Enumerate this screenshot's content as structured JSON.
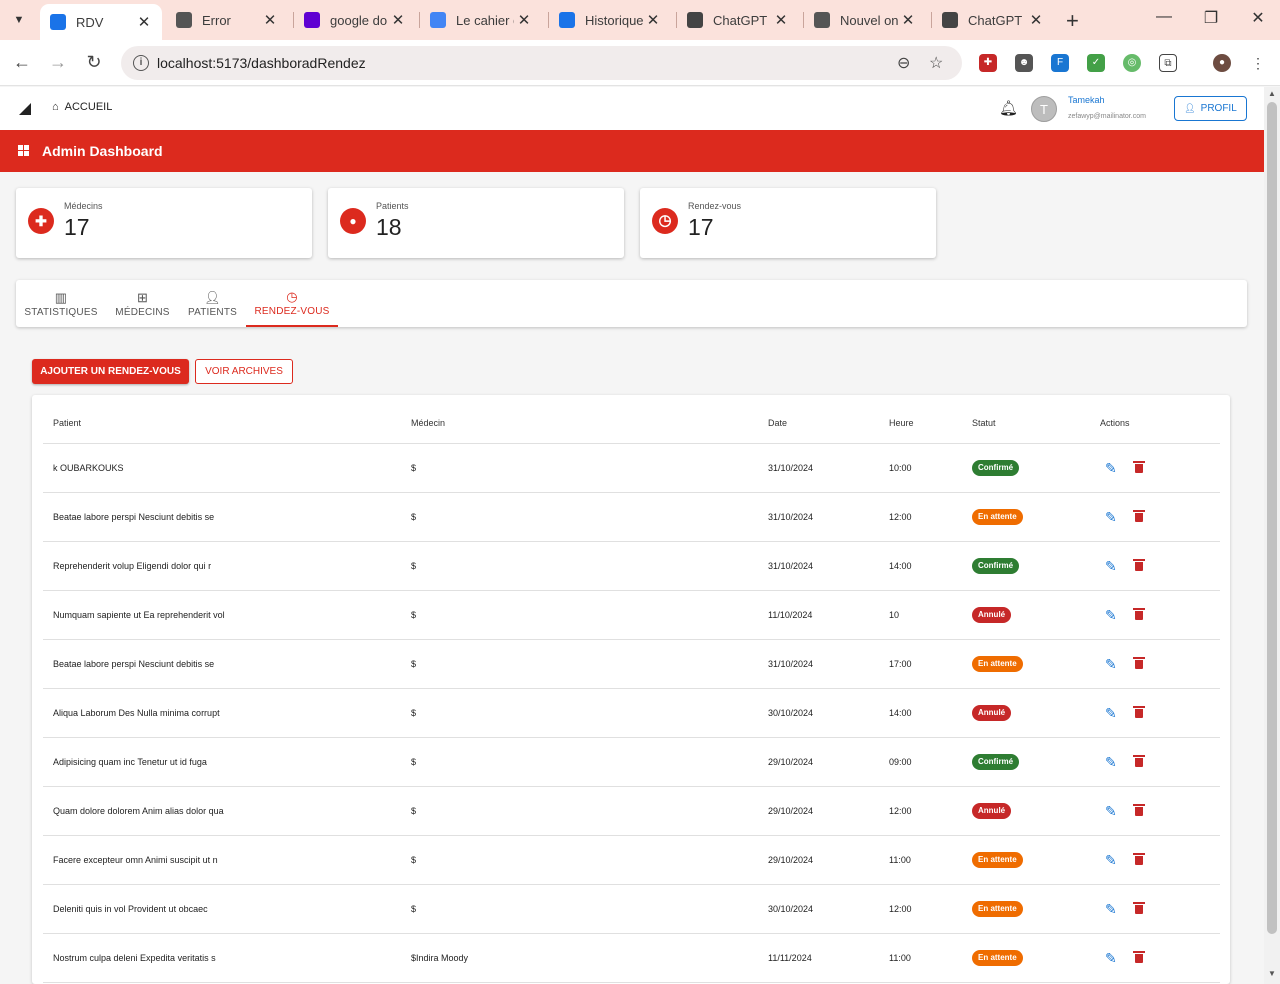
{
  "browser": {
    "tabs": [
      {
        "title": "RDV",
        "icon": "docs-icon",
        "color": "#1a73e8",
        "active": true
      },
      {
        "title": "Error",
        "icon": "globe-icon",
        "color": "#555555"
      },
      {
        "title": "google do",
        "icon": "yahoo-icon",
        "color": "#6001d2"
      },
      {
        "title": "Le cahier d",
        "icon": "docs-icon",
        "color": "#4285f4"
      },
      {
        "title": "Historique",
        "icon": "download-icon",
        "color": "#1a73e8"
      },
      {
        "title": "ChatGPT",
        "icon": "openai-icon",
        "color": "#444444"
      },
      {
        "title": "Nouvel on",
        "icon": "globe-icon",
        "color": "#555555"
      },
      {
        "title": "ChatGPT",
        "icon": "openai-icon",
        "color": "#444444"
      }
    ],
    "url": "localhost:5173/dashboradRendez"
  },
  "header": {
    "home_label": "ACCUEIL",
    "avatar_initial": "T",
    "user_name": "Tamekah",
    "user_email": "zefawyp@mailinator.com",
    "profile_label": "PROFIL"
  },
  "admin_bar": {
    "title": "Admin Dashboard"
  },
  "stats": [
    {
      "label": "Médecins",
      "value": "17",
      "icon": "hospital-icon"
    },
    {
      "label": "Patients",
      "value": "18",
      "icon": "person-icon"
    },
    {
      "label": "Rendez-vous",
      "value": "17",
      "icon": "clock-icon"
    }
  ],
  "tabs": [
    {
      "label": "STATISTIQUES",
      "icon": "chart-icon"
    },
    {
      "label": "MÉDECINS",
      "icon": "hospital-icon"
    },
    {
      "label": "PATIENTS",
      "icon": "person-icon"
    },
    {
      "label": "RENDEZ-VOUS",
      "icon": "clock-icon",
      "active": true
    }
  ],
  "actions": {
    "add_label": "AJOUTER UN RENDEZ-VOUS",
    "archive_label": "VOIR ARCHIVES"
  },
  "table": {
    "headers": {
      "patient": "Patient",
      "medecin": "Médecin",
      "date": "Date",
      "heure": "Heure",
      "statut": "Statut",
      "actions": "Actions"
    },
    "rows": [
      {
        "patient": "k OUBARKOUKS",
        "medecin": "$",
        "date": "31/10/2024",
        "heure": "10:00",
        "statut": "Confirmé"
      },
      {
        "patient": "Beatae labore perspi Nesciunt debitis se",
        "medecin": "$",
        "date": "31/10/2024",
        "heure": "12:00",
        "statut": "En attente"
      },
      {
        "patient": "Reprehenderit volup Eligendi dolor qui r",
        "medecin": "$",
        "date": "31/10/2024",
        "heure": "14:00",
        "statut": "Confirmé"
      },
      {
        "patient": "Numquam sapiente ut Ea reprehenderit vol",
        "medecin": "$",
        "date": "11/10/2024",
        "heure": "10",
        "statut": "Annulé"
      },
      {
        "patient": "Beatae labore perspi Nesciunt debitis se",
        "medecin": "$",
        "date": "31/10/2024",
        "heure": "17:00",
        "statut": "En attente"
      },
      {
        "patient": "Aliqua Laborum Des Nulla minima corrupt",
        "medecin": "$",
        "date": "30/10/2024",
        "heure": "14:00",
        "statut": "Annulé"
      },
      {
        "patient": "Adipisicing quam inc Tenetur ut id fuga",
        "medecin": "$",
        "date": "29/10/2024",
        "heure": "09:00",
        "statut": "Confirmé"
      },
      {
        "patient": "Quam dolore dolorem Anim alias dolor qua",
        "medecin": "$",
        "date": "29/10/2024",
        "heure": "12:00",
        "statut": "Annulé"
      },
      {
        "patient": "Facere excepteur omn Animi suscipit ut n",
        "medecin": "$",
        "date": "29/10/2024",
        "heure": "11:00",
        "statut": "En attente"
      },
      {
        "patient": "Deleniti quis in vol Provident ut obcaec",
        "medecin": "$",
        "date": "30/10/2024",
        "heure": "12:00",
        "statut": "En attente"
      },
      {
        "patient": "Nostrum culpa deleni Expedita veritatis s",
        "medecin": "$Indira Moody",
        "date": "11/11/2024",
        "heure": "11:00",
        "statut": "En attente"
      }
    ]
  },
  "colors": {
    "primary": "#dc2a1e",
    "confirmed": "#2e7d32",
    "pending": "#ef6c00",
    "cancelled": "#c62828",
    "edit": "#1976d2"
  }
}
